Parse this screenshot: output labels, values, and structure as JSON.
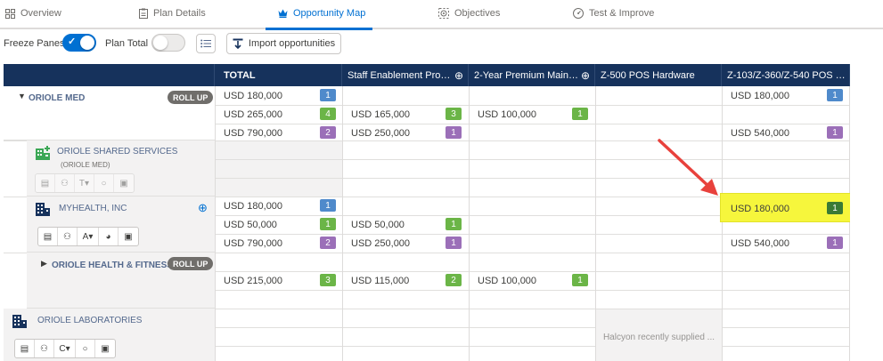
{
  "tabs": [
    {
      "label": "Overview",
      "icon": "grid-icon",
      "active": false
    },
    {
      "label": "Plan Details",
      "icon": "clipboard-icon",
      "active": false
    },
    {
      "label": "Opportunity Map",
      "icon": "crown-icon",
      "active": true
    },
    {
      "label": "Objectives",
      "icon": "target-icon",
      "active": false
    },
    {
      "label": "Test & Improve",
      "icon": "gauge-icon",
      "active": false
    }
  ],
  "toolbar": {
    "freeze_panes_label": "Freeze Panes",
    "freeze_panes_on": true,
    "plan_total_label": "Plan Total",
    "plan_total_on": false,
    "import_label": "Import opportunities"
  },
  "columns": [
    {
      "label": "TOTAL"
    },
    {
      "label": "Staff Enablement Progr...",
      "has_target": true
    },
    {
      "label": "2-Year Premium Mainte...",
      "has_target": true
    },
    {
      "label": "Z-500 POS Hardware",
      "has_target": false
    },
    {
      "label": "Z-103/Z-360/Z-540 POS Soft...",
      "has_target": false
    }
  ],
  "accounts": {
    "oriole_med": {
      "name": "ORIOLE MED",
      "rollup": "ROLL UP"
    },
    "shared_services": {
      "name": "ORIOLE SHARED SERVICES",
      "parent": "(ORIOLE MED)"
    },
    "myhealth": {
      "name": "MYHEALTH, INC",
      "rating": "A"
    },
    "fitness": {
      "name": "ORIOLE HEALTH & FITNESS",
      "rollup": "ROLL UP"
    },
    "laboratories": {
      "name": "ORIOLE LABORATORIES",
      "rating": "C"
    }
  },
  "shared_services_rating": "T",
  "rows": {
    "om1": {
      "total": "USD 180,000",
      "total_n": "1",
      "c4": "USD 180,000",
      "c4_n": "1"
    },
    "om2": {
      "total": "USD 265,000",
      "total_n": "4",
      "c1": "USD 165,000",
      "c1_n": "3",
      "c2": "USD 100,000",
      "c2_n": "1"
    },
    "om3": {
      "total": "USD 790,000",
      "total_n": "2",
      "c1": "USD 250,000",
      "c1_n": "1",
      "c4": "USD 540,000",
      "c4_n": "1"
    },
    "mh1": {
      "total": "USD 180,000",
      "total_n": "1",
      "c4": "USD 180,000",
      "c4_n": "1"
    },
    "mh2": {
      "total": "USD 50,000",
      "total_n": "1",
      "c1": "USD 50,000",
      "c1_n": "1"
    },
    "mh3": {
      "total": "USD 790,000",
      "total_n": "2",
      "c1": "USD 250,000",
      "c1_n": "1",
      "c4": "USD 540,000",
      "c4_n": "1"
    },
    "hf1": {
      "total": "USD 215,000",
      "total_n": "3",
      "c1": "USD 115,000",
      "c1_n": "2",
      "c2": "USD 100,000",
      "c2_n": "1"
    }
  },
  "lab_note": "Halcyon recently supplied ...",
  "colors": {
    "header": "#16325c",
    "accent": "#0070d2",
    "highlight": "#f6f63c",
    "arrow": "#e8413c"
  }
}
